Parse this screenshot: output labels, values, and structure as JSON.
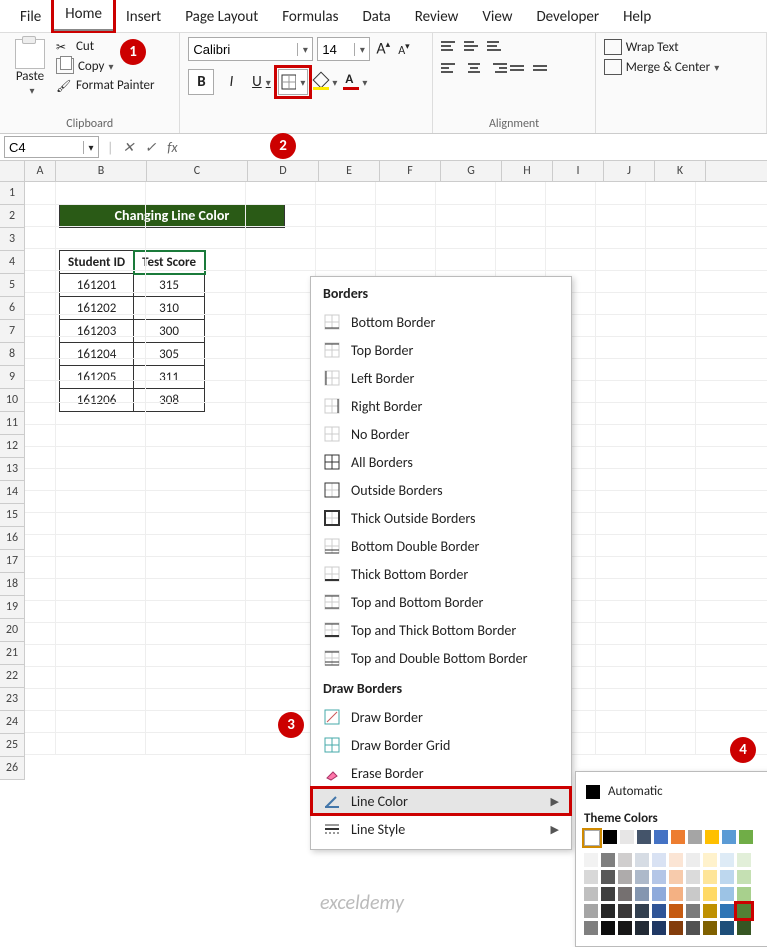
{
  "menu": {
    "file": "File",
    "home": "Home",
    "insert": "Insert",
    "pagelayout": "Page Layout",
    "formulas": "Formulas",
    "data": "Data",
    "review": "Review",
    "view": "View",
    "developer": "Developer",
    "help": "Help"
  },
  "clipboard": {
    "paste": "Paste",
    "cut": "Cut",
    "copy": "Copy",
    "formatpainter": "Format Painter",
    "label": "Clipboard"
  },
  "font": {
    "name": "Calibri",
    "size": "14",
    "increase": "A",
    "decrease": "A",
    "bold": "B",
    "italic": "I",
    "underline": "U"
  },
  "alignment": {
    "wraptext": "Wrap Text",
    "merge": "Merge & Center",
    "label": "Alignment"
  },
  "namebox": "C4",
  "colheads": [
    "A",
    "B",
    "C",
    "D",
    "E",
    "F",
    "G",
    "H",
    "I",
    "J",
    "K"
  ],
  "rowheads": [
    "1",
    "2",
    "3",
    "4",
    "5",
    "6",
    "7",
    "8",
    "9",
    "10",
    "11",
    "12",
    "13",
    "14",
    "15",
    "16",
    "17",
    "18",
    "19",
    "20",
    "21",
    "22",
    "23",
    "24",
    "25",
    "26"
  ],
  "title": "Changing Line Color",
  "table": {
    "headers": [
      "Student ID",
      "Test Score"
    ],
    "rows": [
      [
        "161201",
        "315"
      ],
      [
        "161202",
        "310"
      ],
      [
        "161203",
        "300"
      ],
      [
        "161204",
        "305"
      ],
      [
        "161205",
        "311"
      ],
      [
        "161206",
        "308"
      ]
    ]
  },
  "borders": {
    "hdr1": "Borders",
    "items1": [
      "Bottom Border",
      "Top Border",
      "Left Border",
      "Right Border",
      "No Border",
      "All Borders",
      "Outside Borders",
      "Thick Outside Borders",
      "Bottom Double Border",
      "Thick Bottom Border",
      "Top and Bottom Border",
      "Top and Thick Bottom Border",
      "Top and Double Bottom Border"
    ],
    "hdr2": "Draw Borders",
    "draw": "Draw Border",
    "grid": "Draw Border Grid",
    "erase": "Erase Border",
    "linecolor": "Line Color",
    "linestyle": "Line Style"
  },
  "colorpop": {
    "automatic": "Automatic",
    "theme": "Theme Colors",
    "row0": [
      "#ffffff",
      "#000000",
      "#e7e6e6",
      "#44546a",
      "#4472c4",
      "#ed7d31",
      "#a5a5a5",
      "#ffc000",
      "#5b9bd5",
      "#70ad47"
    ],
    "shades": [
      [
        "#f2f2f2",
        "#7f7f7f",
        "#d0cece",
        "#d6dce4",
        "#d9e2f3",
        "#fbe5d5",
        "#ededed",
        "#fff2cc",
        "#deebf6",
        "#e2efd9"
      ],
      [
        "#d8d8d8",
        "#595959",
        "#aeabab",
        "#adb9ca",
        "#b4c6e7",
        "#f7cbac",
        "#dbdbdb",
        "#fee599",
        "#bdd7ee",
        "#c5e0b3"
      ],
      [
        "#bfbfbf",
        "#3f3f3f",
        "#757070",
        "#8496b0",
        "#8eaadb",
        "#f4b183",
        "#c9c9c9",
        "#ffd965",
        "#9cc3e5",
        "#a8d08d"
      ],
      [
        "#a5a5a5",
        "#262626",
        "#3a3838",
        "#323f4f",
        "#2f5496",
        "#c55a11",
        "#7b7b7b",
        "#bf9000",
        "#2e75b5",
        "#538135"
      ],
      [
        "#7f7f7f",
        "#0c0c0c",
        "#171616",
        "#222a35",
        "#1f3864",
        "#833c0b",
        "#525252",
        "#7f6000",
        "#1e4e79",
        "#375623"
      ]
    ]
  },
  "badges": {
    "b1": "1",
    "b2": "2",
    "b3": "3",
    "b4": "4"
  },
  "watermark": "exceldemy"
}
